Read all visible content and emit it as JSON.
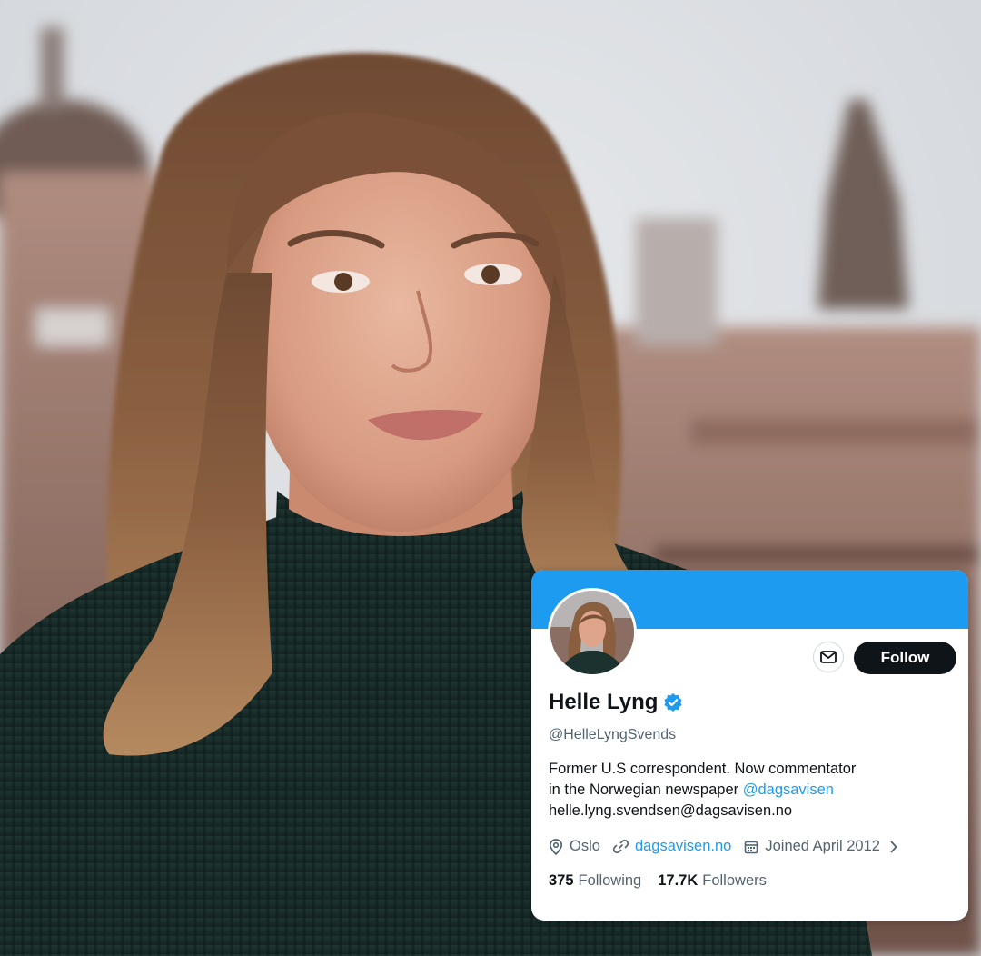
{
  "profile": {
    "display_name": "Helle Lyng",
    "verified": true,
    "handle": "@HelleLyngSvends",
    "bio": {
      "line1": "Former U.S correspondent. Now commentator",
      "line2_prefix": "in the Norwegian newspaper ",
      "line2_mention": "@dagsavisen",
      "line3": "helle.lyng.svendsen@dagsavisen.no"
    },
    "location": "Oslo",
    "website": "dagsavisen.no",
    "joined": "Joined April 2012",
    "following_count": "375",
    "following_label": "Following",
    "followers_count": "17.7K",
    "followers_label": "Followers"
  },
  "actions": {
    "follow_label": "Follow",
    "message_icon": "envelope-icon"
  },
  "colors": {
    "banner": "#1d9bf0",
    "link": "#1d9bf0",
    "follow_button": "#0f1419",
    "secondary_text": "#536471"
  },
  "icons": {
    "verified": "verified-badge-icon",
    "location": "location-pin-icon",
    "link": "link-icon",
    "calendar": "calendar-icon",
    "chevron": "chevron-right-icon"
  }
}
